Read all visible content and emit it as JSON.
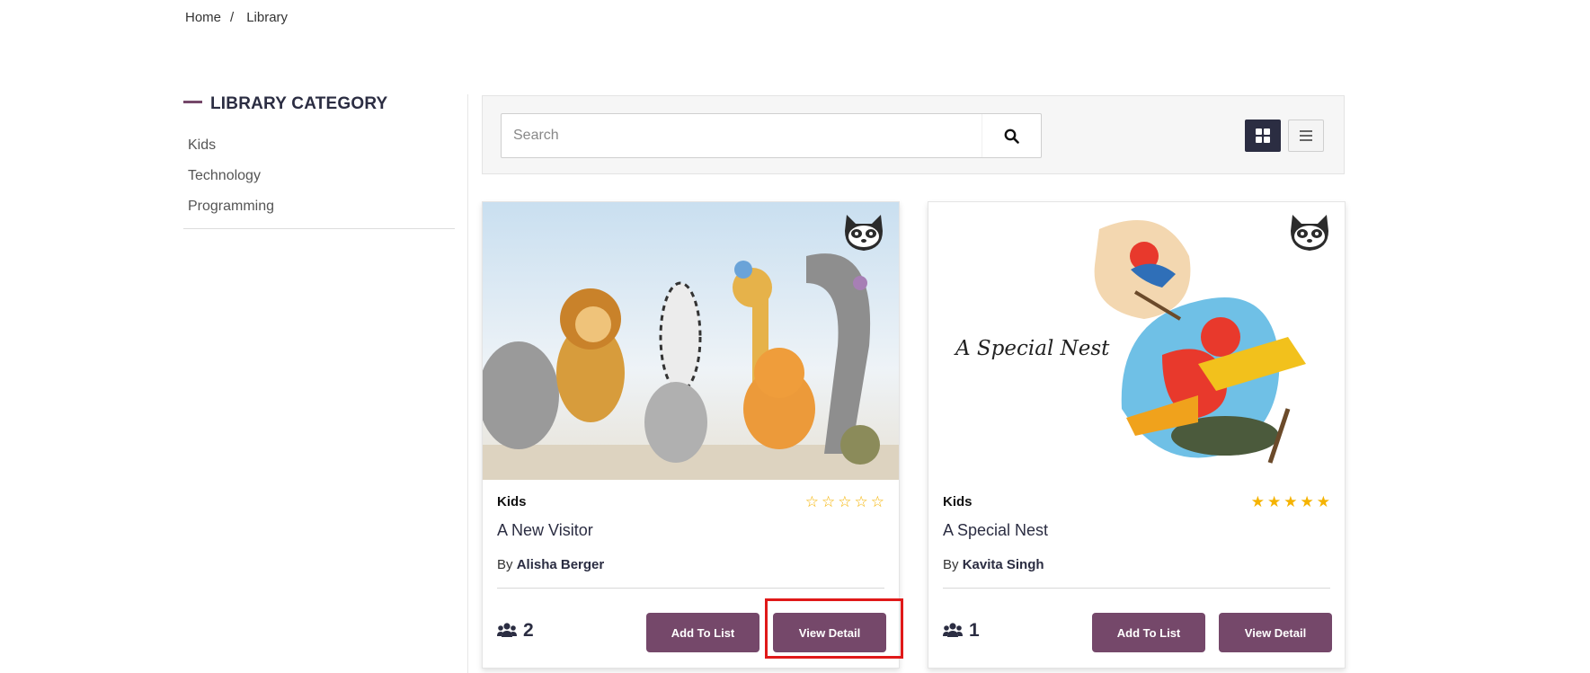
{
  "breadcrumb": {
    "home": "Home",
    "separator": "/",
    "current": "Library"
  },
  "sidebar": {
    "title": "LIBRARY CATEGORY",
    "items": [
      {
        "label": "Kids"
      },
      {
        "label": "Technology"
      },
      {
        "label": "Programming"
      }
    ]
  },
  "toolbar": {
    "search_placeholder": "Search",
    "search_value": "",
    "active_view": "grid"
  },
  "books": [
    {
      "category": "Kids",
      "rating": 0,
      "title": "A New Visitor",
      "author_prefix": "By",
      "author": "Alisha Berger",
      "members": "2",
      "add_label": "Add To List",
      "view_label": "View Detail",
      "cover_icon": "raccoon-icon"
    },
    {
      "category": "Kids",
      "rating": 5,
      "title": "A Special Nest",
      "cover_text": "A Special Nest",
      "author_prefix": "By",
      "author": "Kavita Singh",
      "members": "1",
      "add_label": "Add To List",
      "view_label": "View Detail",
      "cover_icon": "raccoon-icon"
    }
  ],
  "colors": {
    "brand": "#75486a",
    "dark": "#2b2d42",
    "star": "#f5b301",
    "highlight": "#e01919"
  }
}
